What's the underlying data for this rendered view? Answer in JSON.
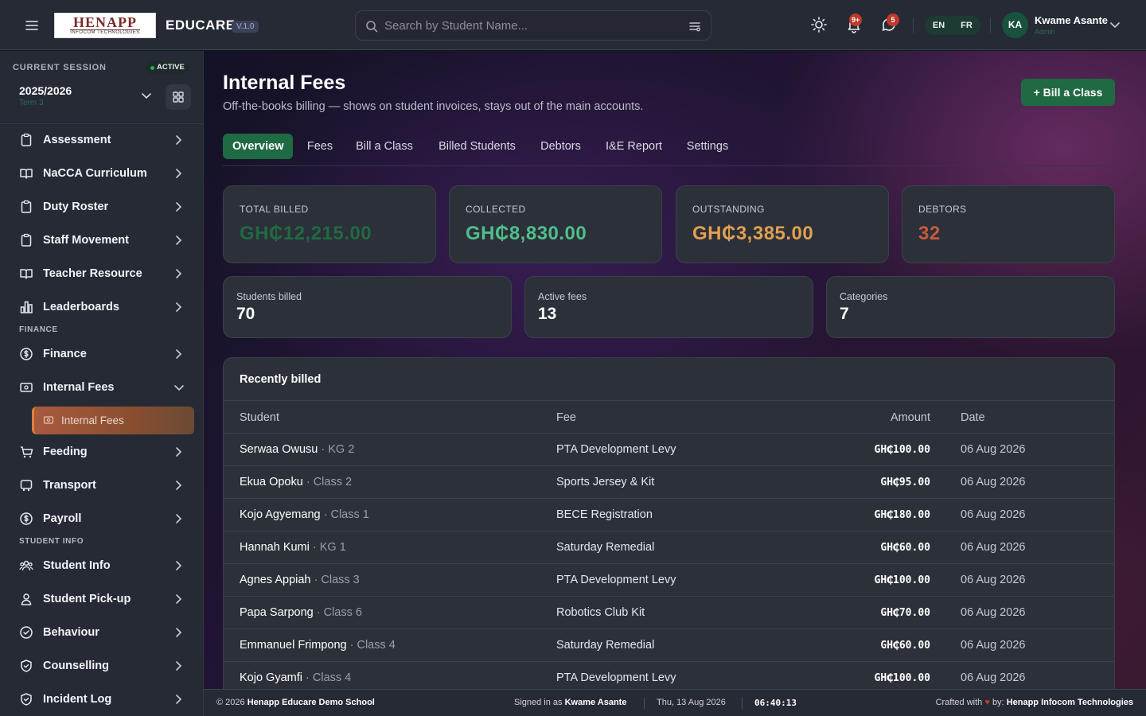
{
  "header": {
    "logo_text": "HENAPP",
    "logo_subtext": "INFOCOM TECHNOLOGIES",
    "app_name": "EDUCARE",
    "version": "V.1.0",
    "search_placeholder": "Search by Student Name...",
    "notifications_badge": "9+",
    "messages_badge": "5",
    "lang_en": "EN",
    "lang_fr": "FR",
    "user_initials": "KA",
    "user_name": "Kwame Asante",
    "user_role": "Admin"
  },
  "sidebar": {
    "session_title": "CURRENT SESSION",
    "session_status": "ACTIVE",
    "session_year": "2025/2026",
    "session_term": "Term 3",
    "items": [
      {
        "label": "Assessment"
      },
      {
        "label": "NaCCA Curriculum"
      },
      {
        "label": "Duty Roster"
      },
      {
        "label": "Staff Movement"
      },
      {
        "label": "Teacher Resource"
      },
      {
        "label": "Leaderboards"
      },
      {
        "label": "Finance"
      },
      {
        "label": "Internal Fees"
      },
      {
        "label": "Feeding"
      },
      {
        "label": "Transport"
      },
      {
        "label": "Payroll"
      },
      {
        "label": "Student Info"
      },
      {
        "label": "Student Pick-up"
      },
      {
        "label": "Behaviour"
      },
      {
        "label": "Counselling"
      },
      {
        "label": "Incident Log"
      }
    ],
    "section_finance": "FINANCE",
    "section_student_info": "STUDENT INFO",
    "sub_item": "Internal Fees"
  },
  "main": {
    "title": "Internal Fees",
    "subtitle": "Off-the-books billing — shows on student invoices, stays out of the main accounts.",
    "bill_button": "+ Bill a Class",
    "tabs": [
      {
        "label": "Overview"
      },
      {
        "label": "Fees"
      },
      {
        "label": "Bill a Class"
      },
      {
        "label": "Billed Students"
      },
      {
        "label": "Debtors"
      },
      {
        "label": "I&E Report"
      },
      {
        "label": "Settings"
      }
    ],
    "stats": [
      {
        "label": "TOTAL BILLED",
        "value": "GH₵12,215.00",
        "color": "#1f6a43"
      },
      {
        "label": "COLLECTED",
        "value": "GH₵8,830.00",
        "color": "#4fbf8c"
      },
      {
        "label": "OUTSTANDING",
        "value": "GH₵3,385.00",
        "color": "#e0a050"
      },
      {
        "label": "DEBTORS",
        "value": "32",
        "color": "#c85a3c"
      }
    ],
    "mini_stats": [
      {
        "label": "Students billed",
        "value": "70"
      },
      {
        "label": "Active fees",
        "value": "13"
      },
      {
        "label": "Categories",
        "value": "7"
      }
    ],
    "recent": {
      "title": "Recently billed",
      "headers": {
        "student": "Student",
        "fee": "Fee",
        "amount": "Amount",
        "date": "Date"
      },
      "rows": [
        {
          "student": "Serwaa Owusu",
          "class": "· KG 2",
          "fee": "PTA Development Levy",
          "amount": "GH₵100.00",
          "date": "06 Aug 2026"
        },
        {
          "student": "Ekua Opoku",
          "class": "· Class 2",
          "fee": "Sports Jersey & Kit",
          "amount": "GH₵95.00",
          "date": "06 Aug 2026"
        },
        {
          "student": "Kojo Agyemang",
          "class": "· Class 1",
          "fee": "BECE Registration",
          "amount": "GH₵180.00",
          "date": "06 Aug 2026"
        },
        {
          "student": "Hannah Kumi",
          "class": "· KG 1",
          "fee": "Saturday Remedial",
          "amount": "GH₵60.00",
          "date": "06 Aug 2026"
        },
        {
          "student": "Agnes Appiah",
          "class": "· Class 3",
          "fee": "PTA Development Levy",
          "amount": "GH₵100.00",
          "date": "06 Aug 2026"
        },
        {
          "student": "Papa Sarpong",
          "class": "· Class 6",
          "fee": "Robotics Club Kit",
          "amount": "GH₵70.00",
          "date": "06 Aug 2026"
        },
        {
          "student": "Emmanuel Frimpong",
          "class": "· Class 4",
          "fee": "Saturday Remedial",
          "amount": "GH₵60.00",
          "date": "06 Aug 2026"
        },
        {
          "student": "Kojo Gyamfi",
          "class": "· Class 4",
          "fee": "PTA Development Levy",
          "amount": "GH₵100.00",
          "date": "06 Aug 2026"
        }
      ]
    }
  },
  "footer": {
    "copyright_prefix": "© 2026",
    "school": "Henapp Educare Demo School",
    "signed_in_prefix": "Signed in as",
    "signed_in_user": "Kwame Asante",
    "date": "Thu, 13 Aug 2026",
    "time": "06:40:13",
    "crafted_prefix": "Crafted with",
    "crafted_by": "by:",
    "company": "Henapp Infocom Technologies"
  }
}
